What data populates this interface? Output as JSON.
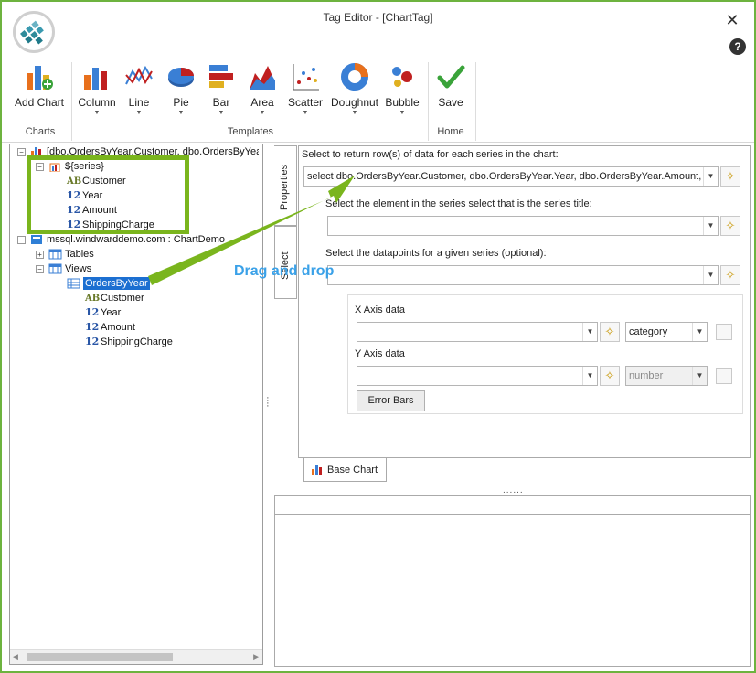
{
  "window": {
    "title": "Tag Editor - [ChartTag]",
    "close_glyph": "✕",
    "help_glyph": "?"
  },
  "ribbon": {
    "add_chart": "Add Chart",
    "column": "Column",
    "line": "Line",
    "pie": "Pie",
    "bar": "Bar",
    "area": "Area",
    "scatter": "Scatter",
    "doughnut": "Doughnut",
    "bubble": "Bubble",
    "save": "Save",
    "group_charts": "Charts",
    "group_templates": "Templates",
    "group_home": "Home",
    "dropdown_glyph": "▼"
  },
  "tree": {
    "root_label": "[dbo.OrdersByYear.Customer, dbo.OrdersByYear.Year, dbo.OrdersByYear.Amount, dbo.OrdersByYear.ShippingCharge]",
    "series_label": "${series}",
    "series_fields": [
      {
        "type_glyph": "AB",
        "name": "Customer"
      },
      {
        "type_glyph": "12",
        "name": "Year"
      },
      {
        "type_glyph": "12",
        "name": "Amount"
      },
      {
        "type_glyph": "12",
        "name": "ShippingCharge"
      }
    ],
    "datasource_label": "mssql.windwarddemo.com : ChartDemo",
    "tables_label": "Tables",
    "views_label": "Views",
    "view_selected": "OrdersByYear",
    "view_fields": [
      {
        "type_glyph": "AB",
        "name": "Customer"
      },
      {
        "type_glyph": "12",
        "name": "Year"
      },
      {
        "type_glyph": "12",
        "name": "Amount"
      },
      {
        "type_glyph": "12",
        "name": "ShippingCharge"
      }
    ],
    "expand_minus": "−",
    "expand_plus": "+"
  },
  "side_tabs": {
    "properties": "Properties",
    "select": "Select"
  },
  "form": {
    "series_select_label": "Select to return row(s) of data for each series in the chart:",
    "series_select_value": "select dbo.OrdersByYear.Customer, dbo.OrdersByYear.Year, dbo.OrdersByYear.Amount, dbo.OrdersByYear.ShippingCharge",
    "title_label": "Select the element in the series select that is the series title:",
    "title_value": "",
    "datapoints_label": "Select the datapoints for a given series (optional):",
    "datapoints_value": "",
    "x_axis_label": "X Axis data",
    "x_axis_value": "",
    "x_axis_type": "category",
    "y_axis_label": "Y Axis data",
    "y_axis_value": "",
    "y_axis_type": "number",
    "error_bars_button": "Error Bars",
    "base_chart_tab": "Base Chart",
    "grip": "......"
  },
  "annotation": {
    "drag_text": "Drag and drop",
    "highlight_color": "#7ab51d",
    "text_color": "#3aa1e8"
  },
  "colors": {
    "accent_green": "#6db33f",
    "selection_blue": "#1c6fd1"
  }
}
